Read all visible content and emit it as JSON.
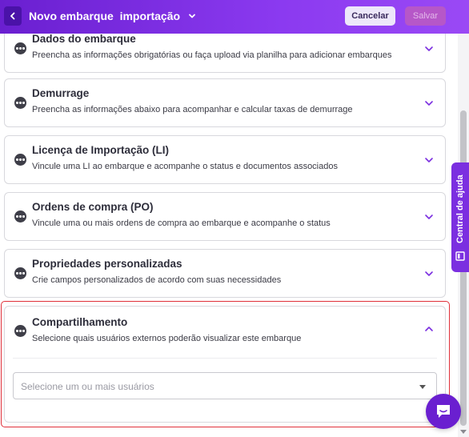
{
  "header": {
    "title": "Novo embarque  importação",
    "cancel_label": "Cancelar",
    "save_label": "Salvar"
  },
  "sections": [
    {
      "title": "Dados do embarque",
      "description": "Preencha as informações obrigatórias ou faça upload via planilha para adicionar embarques",
      "expanded": false
    },
    {
      "title": "Demurrage",
      "description": "Preencha as informações abaixo para acompanhar e calcular taxas de demurrage",
      "expanded": false
    },
    {
      "title": "Licença de Importação (LI)",
      "description": "Vincule uma LI ao embarque e acompanhe o status e documentos associados",
      "expanded": false
    },
    {
      "title": "Ordens de compra (PO)",
      "description": "Vincule uma ou mais ordens de compra ao embarque e acompanhe o status",
      "expanded": false
    },
    {
      "title": "Propriedades personalizadas",
      "description": "Crie campos personalizados de acordo com suas necessidades",
      "expanded": false
    },
    {
      "title": "Compartilhamento",
      "description": "Selecione quais usuários externos poderão visualizar este embarque",
      "expanded": true
    }
  ],
  "sharing": {
    "users_select_placeholder": "Selecione um ou mais usuários"
  },
  "help_tab": {
    "label": "Central de ajuda"
  },
  "colors": {
    "header_gradient_start": "#6a1fd0",
    "header_gradient_end": "#9a49f5",
    "accent": "#7b2fe0",
    "highlight_border": "#e0303a",
    "save_button_bg": "#b657c8"
  },
  "icons": {
    "back": "chevron-left-icon",
    "title_dropdown": "chevron-down-icon",
    "section": "more-dots-icon",
    "collapsed": "chevron-down-icon",
    "expanded": "chevron-up-icon",
    "help": "book-icon",
    "chat": "chat-bubble-icon"
  }
}
